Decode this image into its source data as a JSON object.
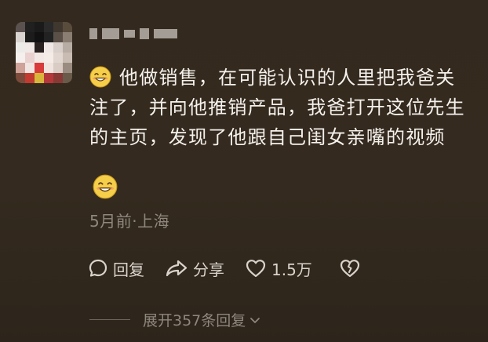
{
  "comment": {
    "text_line1": "他做销售，在可能认识的人里把我爸关",
    "text_line2": "注了，并向他推销产品，我爸打开这位先生",
    "text_line3": "的主页，发现了他跟自己闺女亲嘴的视频",
    "lead_emoji": "smile-emoji",
    "trail_emoji": "smile-emoji"
  },
  "meta": {
    "time_location": "5月前·上海"
  },
  "actions": {
    "reply_label": "回复",
    "share_label": "分享",
    "like_count": "1.5万"
  },
  "replies": {
    "expand_label": "展开357条回复"
  },
  "colors": {
    "background": "#33291e",
    "text": "#f4f1ec",
    "muted": "#8e877d",
    "emoji_yellow": "#f6cf4a"
  }
}
